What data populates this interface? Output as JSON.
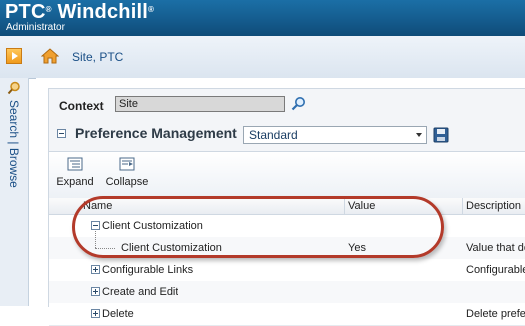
{
  "banner": {
    "brand": "PTC",
    "brand_reg": "®",
    "product": " Windchill",
    "product_reg": "®",
    "role": "Administrator"
  },
  "header": {
    "breadcrumb": "Site, PTC"
  },
  "left_rail": {
    "search": "Search",
    "separator": "|",
    "browse": "Browse"
  },
  "context": {
    "label": "Context",
    "value": "Site"
  },
  "section": {
    "title": "Preference Management",
    "view": "Standard"
  },
  "toolbar": {
    "expand_label": "Expand",
    "collapse_label": "Collapse"
  },
  "table": {
    "columns": [
      "Name",
      "Value",
      "Description"
    ],
    "rows": [
      {
        "name": "Client Customization",
        "value": "",
        "description": "",
        "level": 0,
        "toggle": "minus"
      },
      {
        "name": "Client Customization",
        "value": "Yes",
        "description": "Value that det",
        "level": 1,
        "toggle": ""
      },
      {
        "name": "Configurable Links",
        "value": "",
        "description": "Configurable",
        "level": 0,
        "toggle": "plus"
      },
      {
        "name": "Create and Edit",
        "value": "",
        "description": "",
        "level": 0,
        "toggle": "plus"
      },
      {
        "name": "Delete",
        "value": "",
        "description": "Delete prefere",
        "level": 0,
        "toggle": "plus"
      }
    ]
  },
  "colors": {
    "banner": "#145a8c",
    "highlight": "#b33a2a",
    "link": "#1a4f86"
  }
}
